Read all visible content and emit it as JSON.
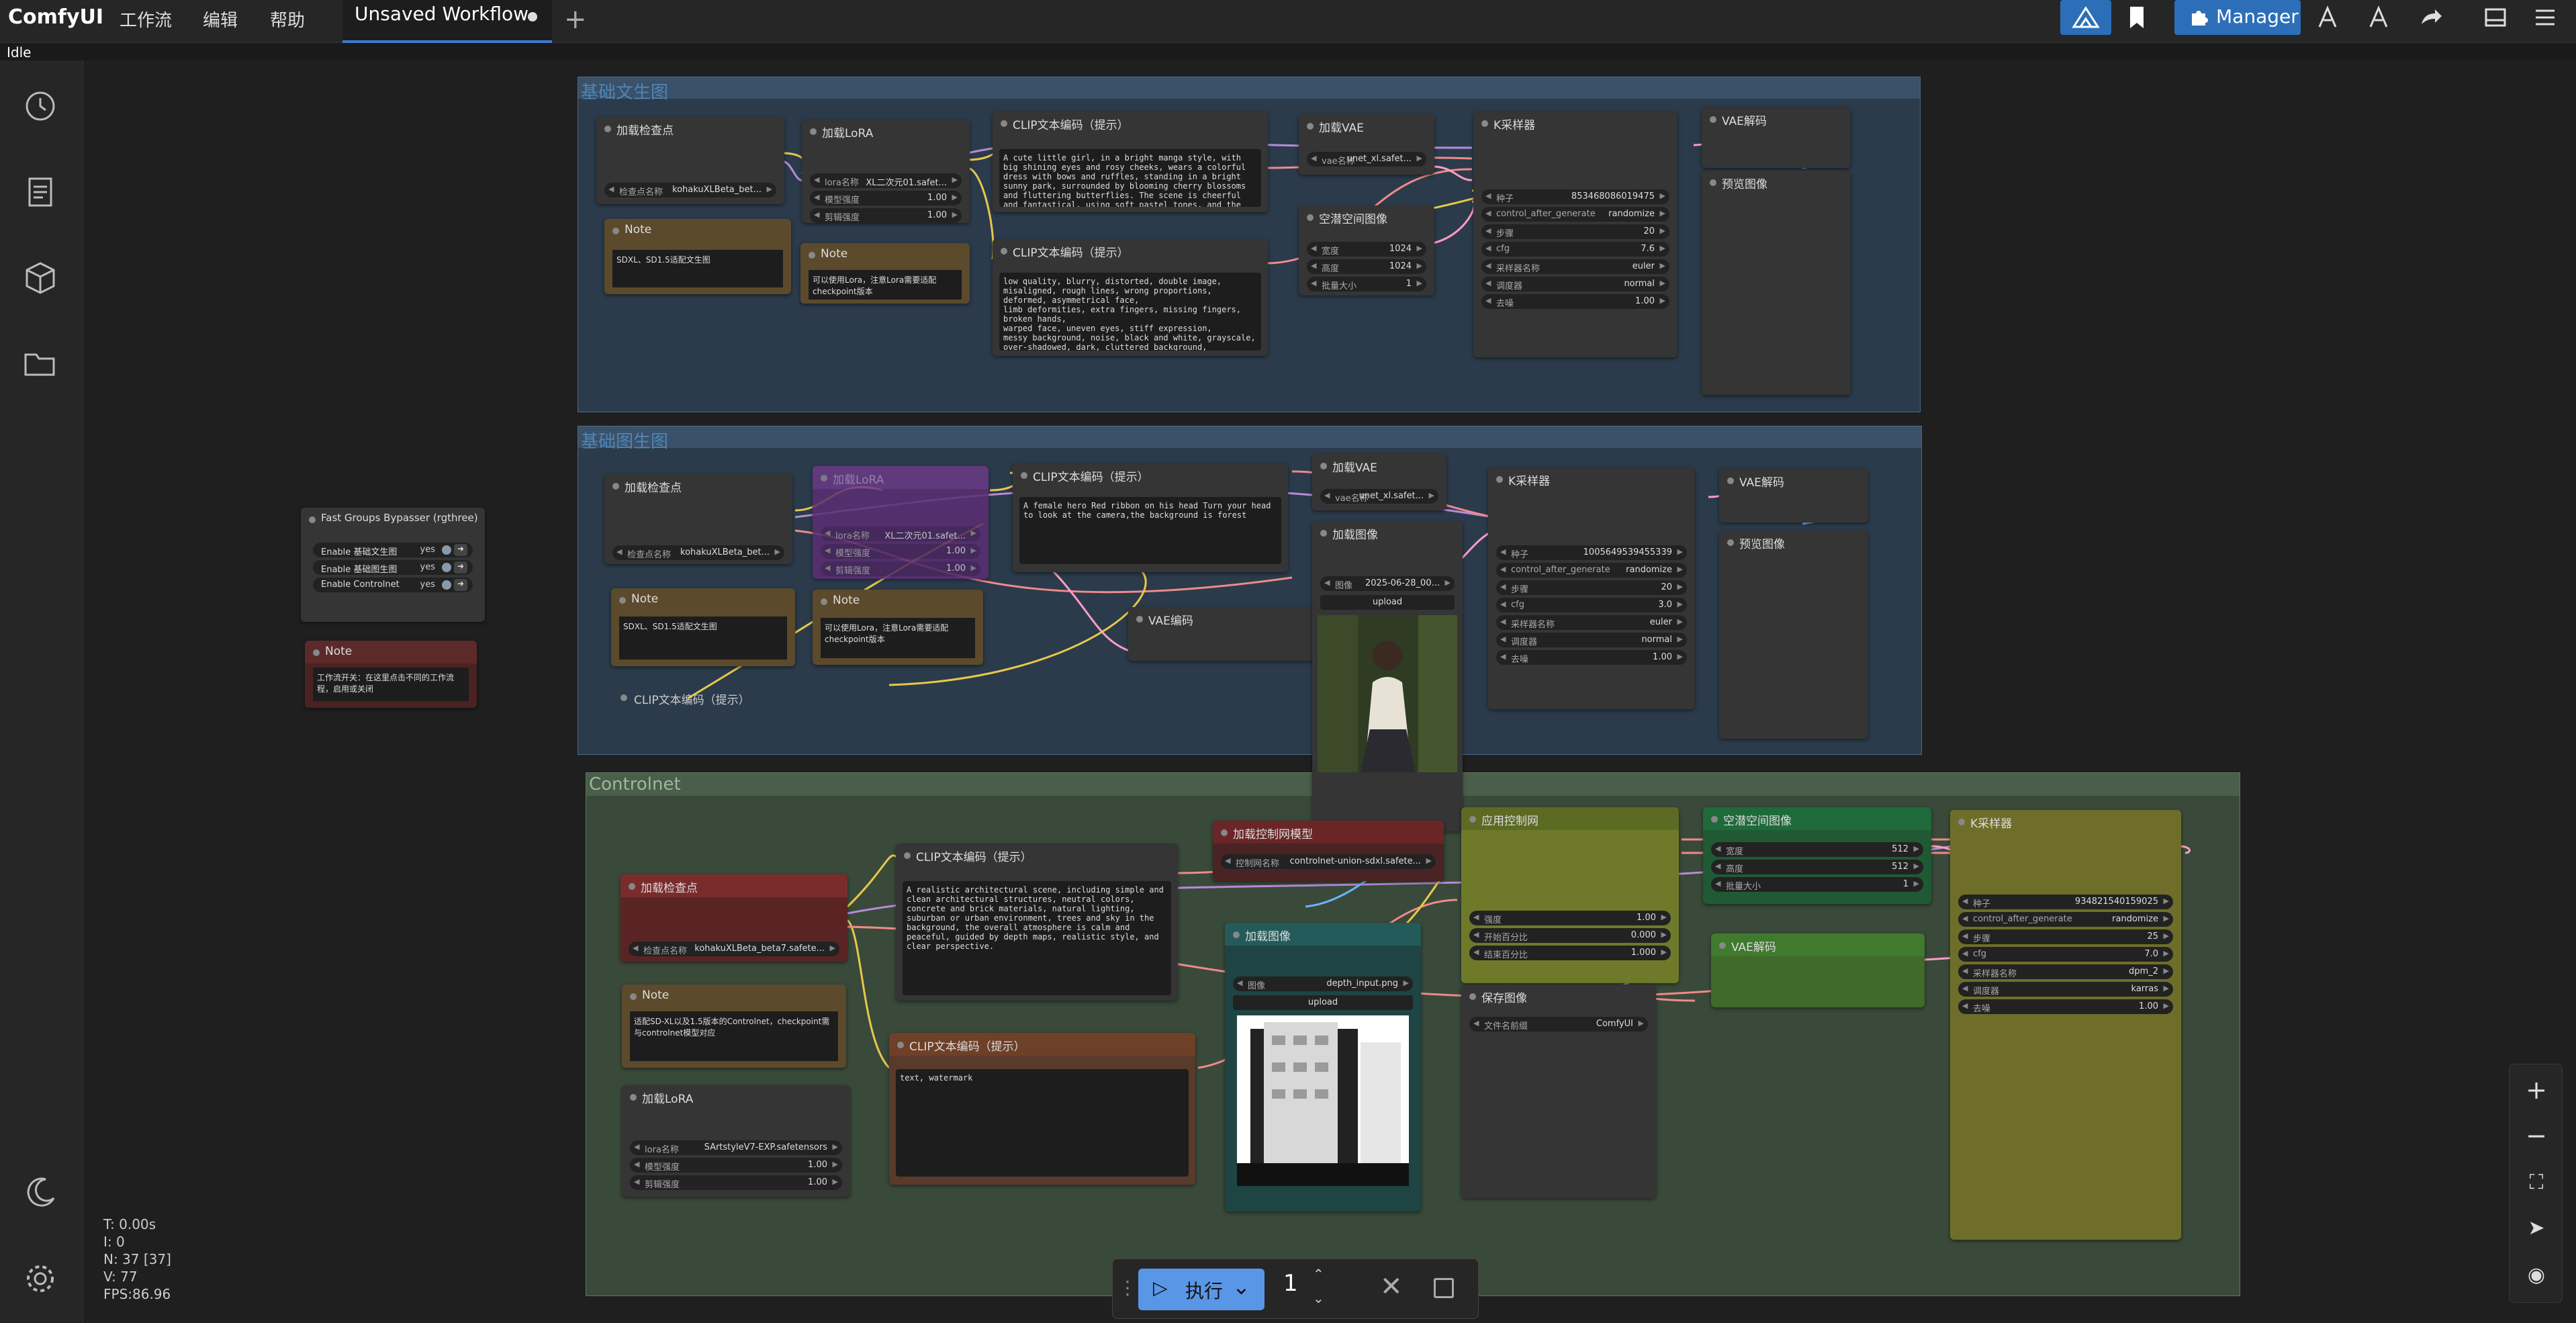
{
  "app": {
    "name": "ComfyUI",
    "status": "Idle"
  },
  "menu": [
    "工作流",
    "编辑",
    "帮助"
  ],
  "tab": {
    "label": "Unsaved Workflow"
  },
  "manager_label": "Manager",
  "stats": {
    "t": "T: 0.00s",
    "i": "I: 0",
    "n": "N: 37 [37]",
    "v": "V: 77",
    "fps": "FPS:86.96"
  },
  "run": {
    "label": "执行",
    "batch": "1"
  },
  "groups": {
    "g1": "基础文生图",
    "g2": "基础图生图",
    "g3": "Controlnet"
  },
  "g1": {
    "ckpt": {
      "title": "加载检查点",
      "label": "检查点名称",
      "value": "kohakuXLBeta_bet..."
    },
    "note1": {
      "title": "Note",
      "text": "SDXL、SD1.5适配文生图"
    },
    "lora": {
      "title": "加载LoRA",
      "lora_name_label": "lora名称",
      "lora_name": "XL二次元01.safet...",
      "model_strength_label": "模型强度",
      "model_strength": "1.00",
      "clip_strength_label": "剪辑强度",
      "clip_strength": "1.00"
    },
    "note2": {
      "title": "Note",
      "text": "可以使用Lora，注意Lora需要适配checkpoint版本"
    },
    "clip_pos": {
      "title": "CLIP文本编码（提示）",
      "text": "A cute little girl, in a bright manga style, with big shining eyes and rosy cheeks, wears a colorful dress with bows and ruffles, standing in a bright sunny park, surrounded by blooming cherry blossoms and fluttering butterflies. The scene is cheerful and fantastical, using soft pastel tones, and the lines are vivid and expressive, with charming cartoon details. With a clear blue sky and"
    },
    "clip_neg": {
      "title": "CLIP文本编码（提示）",
      "text": "low quality, blurry, distorted, double image, misaligned, rough lines, wrong proportions, deformed, asymmetrical face,\nlimb deformities, extra fingers, missing fingers, broken hands,\nwarped face, uneven eyes, stiff expression,\nmessy background, noise, black and white, grayscale,\nover-shadowed, dark, cluttered background,"
    },
    "vae": {
      "title": "加载VAE",
      "label": "vae名称",
      "value": "unet_xl.safet..."
    },
    "latent": {
      "title": "空潜空间图像",
      "w_label": "宽度",
      "w": "1024",
      "h_label": "高度",
      "h": "1024",
      "b_label": "批量大小",
      "b": "1"
    },
    "ksampler": {
      "title": "K采样器",
      "seed_label": "种子",
      "seed": "853468086019475",
      "cag_label": "control_after_generate",
      "cag": "randomize",
      "steps_label": "步骤",
      "steps": "20",
      "cfg_label": "cfg",
      "cfg": "7.6",
      "sampler_label": "采样器名称",
      "sampler": "euler",
      "sched_label": "调度器",
      "sched": "normal",
      "denoise_label": "去噪",
      "denoise": "1.00"
    },
    "vaedec": {
      "title": "VAE解码"
    },
    "preview": {
      "title": "预览图像"
    }
  },
  "g2": {
    "ckpt": {
      "title": "加载检查点",
      "label": "检查点名称",
      "value": "kohakuXLBeta_bet..."
    },
    "lora": {
      "title": "加载LoRA",
      "lora_name_label": "lora名称",
      "lora_name": "XL二次元01.safet...",
      "model_strength_label": "模型强度",
      "model_strength": "1.00",
      "clip_strength_label": "剪辑强度",
      "clip_strength": "1.00"
    },
    "clip_pos": {
      "title": "CLIP文本编码（提示）",
      "text": "A female hero Red ribbon on his head Turn your head to look at the camera,the background is forest"
    },
    "note1": {
      "title": "Note",
      "text": "SDXL、SD1.5适配文生图"
    },
    "note2": {
      "title": "Note",
      "text": "可以使用Lora，注意Lora需要适配checkpoint版本"
    },
    "clip_neg": {
      "title": "CLIP文本编码（提示）"
    },
    "vae": {
      "title": "加载VAE",
      "label": "vae名称",
      "value": "unet_xl.safet..."
    },
    "vaeenc": {
      "title": "VAE编码"
    },
    "loadimg": {
      "title": "加载图像",
      "label": "图像",
      "value": "2025-06-28_00...",
      "upload": "upload"
    },
    "ksampler": {
      "title": "K采样器",
      "seed_label": "种子",
      "seed": "1005649539455339",
      "cag_label": "control_after_generate",
      "cag": "randomize",
      "steps_label": "步骤",
      "steps": "20",
      "cfg_label": "cfg",
      "cfg": "3.0",
      "sampler_label": "采样器名称",
      "sampler": "euler",
      "sched_label": "调度器",
      "sched": "normal",
      "denoise_label": "去噪",
      "denoise": "1.00"
    },
    "vaedec": {
      "title": "VAE解码"
    },
    "preview": {
      "title": "预览图像"
    }
  },
  "bypasser": {
    "title": "Fast Groups Bypasser (rgthree)",
    "rows": [
      {
        "label": "Enable 基础文生图",
        "value": "yes"
      },
      {
        "label": "Enable 基础图生图",
        "value": "yes"
      },
      {
        "label": "Enable Controlnet",
        "value": "yes"
      }
    ]
  },
  "note_red": {
    "title": "Note",
    "text": "工作流开关：在这里点击不同的工作流程，启用或关闭"
  },
  "g3": {
    "ckpt": {
      "title": "加载检查点",
      "label": "检查点名称",
      "value": "kohakuXLBeta_beta7.safete..."
    },
    "note": {
      "title": "Note",
      "text": "适配SD-XL以及1.5版本的Controlnet，checkpoint需与controlnet模型对应"
    },
    "lora": {
      "title": "加载LoRA",
      "lora_name_label": "lora名称",
      "lora_name": "SArtstyleV7-EXP.safetensors",
      "model_strength_label": "模型强度",
      "model_strength": "1.00",
      "clip_strength_label": "剪辑强度",
      "clip_strength": "1.00"
    },
    "clip_pos": {
      "title": "CLIP文本编码（提示）",
      "text": "A realistic architectural scene, including simple and clean architectural structures, neutral colors, concrete and brick materials, natural lighting, suburban or urban environment, trees and sky in the background, the overall atmosphere is calm and peaceful, guided by depth maps, realistic style, and clear perspective."
    },
    "clip_neg": {
      "title": "CLIP文本编码（提示）",
      "text": "text, watermark"
    },
    "cnload": {
      "title": "加载控制网模型",
      "label": "控制网名称",
      "value": "controlnet-union-sdxl.safete..."
    },
    "loadimg": {
      "title": "加载图像",
      "label": "图像",
      "value": "depth_input.png",
      "upload": "upload"
    },
    "apply": {
      "title": "应用控制网",
      "s_label": "强度",
      "s": "1.00",
      "st_label": "开始百分比",
      "st": "0.000",
      "en_label": "结束百分比",
      "en": "1.000"
    },
    "latent": {
      "title": "空潜空间图像",
      "w_label": "宽度",
      "w": "512",
      "h_label": "高度",
      "h": "512",
      "b_label": "批量大小",
      "b": "1"
    },
    "vaedec": {
      "title": "VAE解码"
    },
    "save": {
      "title": "保存图像",
      "label": "文件名前缀",
      "value": "ComfyUI"
    },
    "ksampler": {
      "title": "K采样器",
      "seed_label": "种子",
      "seed": "934821540159025",
      "cag_label": "control_after_generate",
      "cag": "randomize",
      "steps_label": "步骤",
      "steps": "25",
      "cfg_label": "cfg",
      "cfg": "7.0",
      "sampler_label": "采样器名称",
      "sampler": "dpm_2",
      "sched_label": "调度器",
      "sched": "karras",
      "denoise_label": "去噪",
      "denoise": "1.00"
    }
  },
  "colors": {
    "accent": "#2c6fb8",
    "run": "#5a96e6",
    "group1": "#3a5169",
    "group3": "#4a5e4a"
  }
}
